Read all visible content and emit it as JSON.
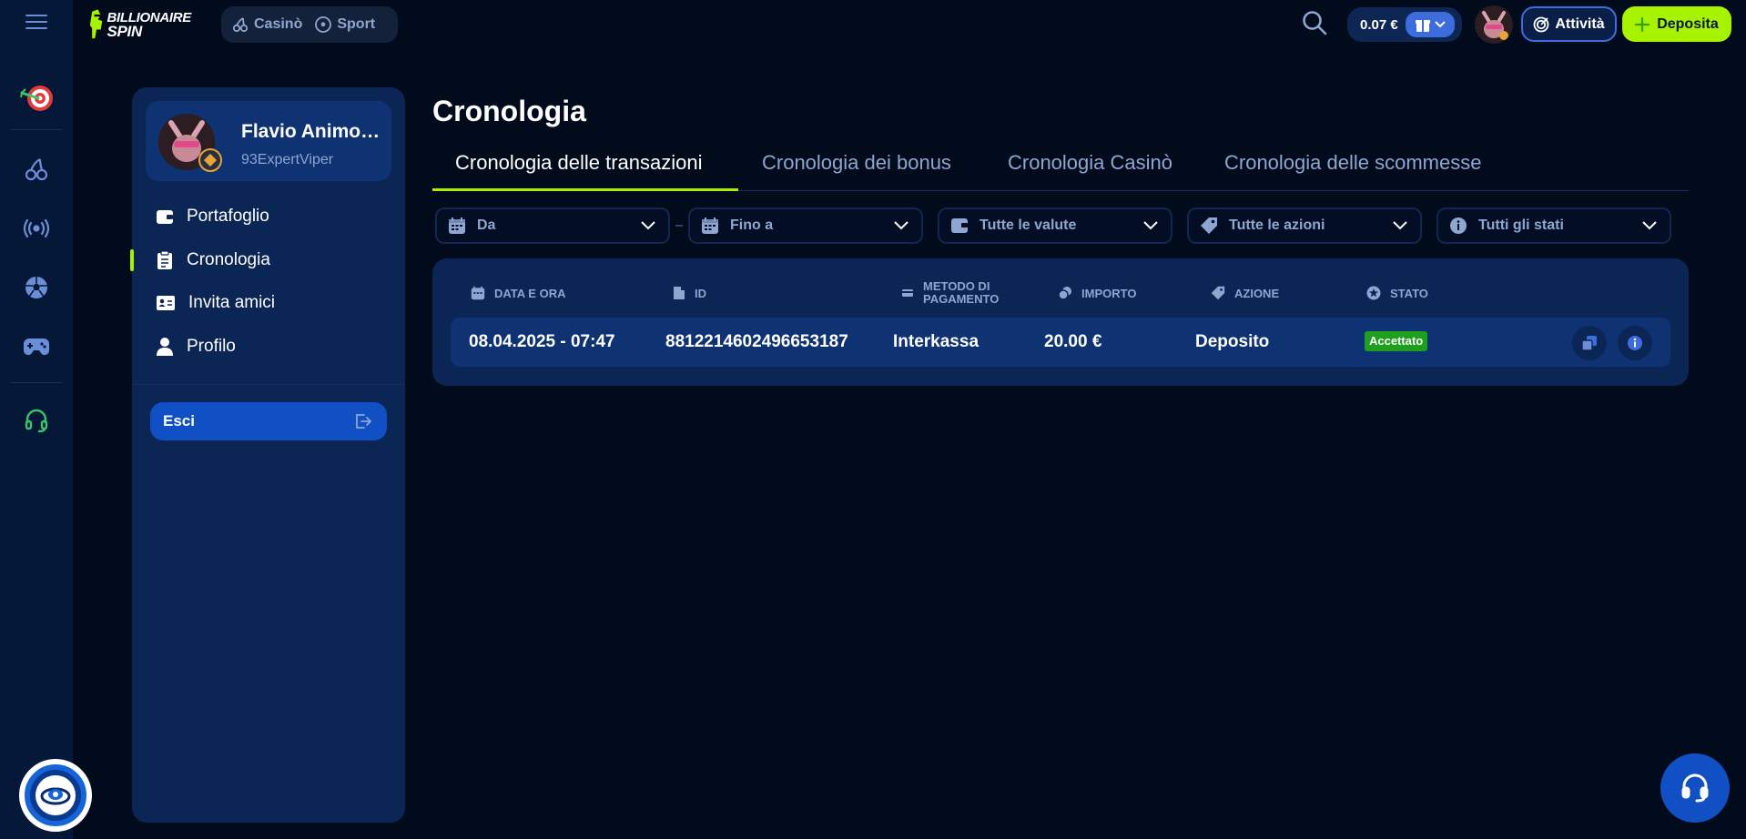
{
  "colors": {
    "background": "#020b1c",
    "rail": "#061838",
    "panel": "#0b2554",
    "accent_green": "#a6f200",
    "accent_blue": "#3d6ddd",
    "status_accepted": "#1da01d",
    "muted_text": "#8ea6d0"
  },
  "logo": {
    "line1": "BILLIONAIRE",
    "line2": "SPIN"
  },
  "mode_switch": {
    "casino": "Casinò",
    "sport": "Sport"
  },
  "header": {
    "balance": "0.07 €",
    "activity_label": "Attività",
    "deposit_label": "Deposita"
  },
  "rail": {
    "icons": [
      "menu-icon",
      "darts-target-icon",
      "cherry-icon",
      "live-signal-icon",
      "football-icon",
      "gamepad-icon",
      "headset-icon"
    ]
  },
  "profile": {
    "name": "Flavio Animob...",
    "username": "93ExpertViper",
    "menu": [
      {
        "label": "Portafoglio",
        "icon": "wallet-icon"
      },
      {
        "label": "Cronologia",
        "icon": "clipboard-icon",
        "active": true
      },
      {
        "label": "Invita amici",
        "icon": "id-card-icon"
      },
      {
        "label": "Profilo",
        "icon": "user-icon"
      }
    ],
    "logout_label": "Esci"
  },
  "page": {
    "title": "Cronologia",
    "tabs": [
      {
        "label": "Cronologia delle transazioni",
        "active": true
      },
      {
        "label": "Cronologia dei bonus"
      },
      {
        "label": "Cronologia Casinò"
      },
      {
        "label": "Cronologia delle scommesse"
      }
    ],
    "filters": {
      "from": "Da",
      "to": "Fino a",
      "currency": "Tutte le valute",
      "action": "Tutte le azioni",
      "status": "Tutti gli stati"
    }
  },
  "table": {
    "headers": {
      "date": "DATA E ORA",
      "id": "ID",
      "method_line1": "METODO DI",
      "method_line2": "PAGAMENTO",
      "amount": "IMPORTO",
      "action": "AZIONE",
      "status": "STATO"
    },
    "rows": [
      {
        "date": "08.04.2025 - 07:47",
        "id": "8812214602496653187",
        "method": "Interkassa",
        "amount": "20.00 €",
        "action": "Deposito",
        "status": "Accettato"
      }
    ]
  }
}
